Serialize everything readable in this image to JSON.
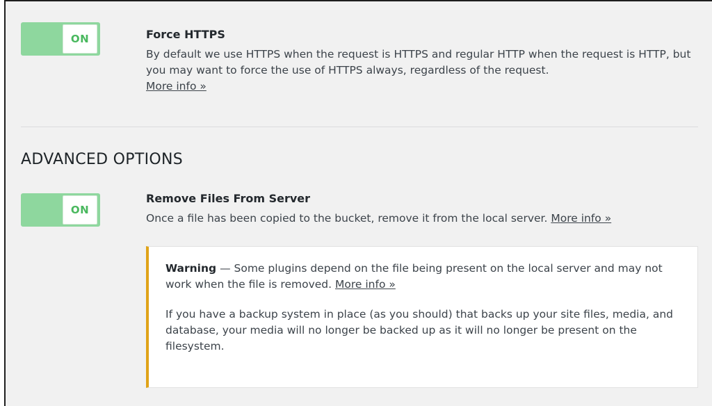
{
  "force_https": {
    "toggle_label": "ON",
    "title": "Force HTTPS",
    "description": "By default we use HTTPS when the request is HTTPS and regular HTTP when the request is HTTP, but you may want to force the use of HTTPS always, regardless of the request.",
    "more_info": "More info »"
  },
  "advanced_options": {
    "heading": "ADVANCED OPTIONS",
    "remove_files": {
      "toggle_label": "ON",
      "title": "Remove Files From Server",
      "description": "Once a file has been copied to the bucket, remove it from the local server.",
      "more_info": "More info »"
    },
    "warning": {
      "label": "Warning",
      "dash": " — ",
      "text": "Some plugins depend on the file being present on the local server and may not work when the file is removed.",
      "more_info": "More info »",
      "backup_text": "If you have a backup system in place (as you should) that backs up your site files, media, and database, your media will no longer be backed up as it will no longer be present on the filesystem."
    }
  },
  "colors": {
    "toggle_on": "#8ed79e",
    "toggle_text": "#49b85e",
    "warning_border": "#e0a318",
    "panel_bg": "#f1f1f1"
  }
}
